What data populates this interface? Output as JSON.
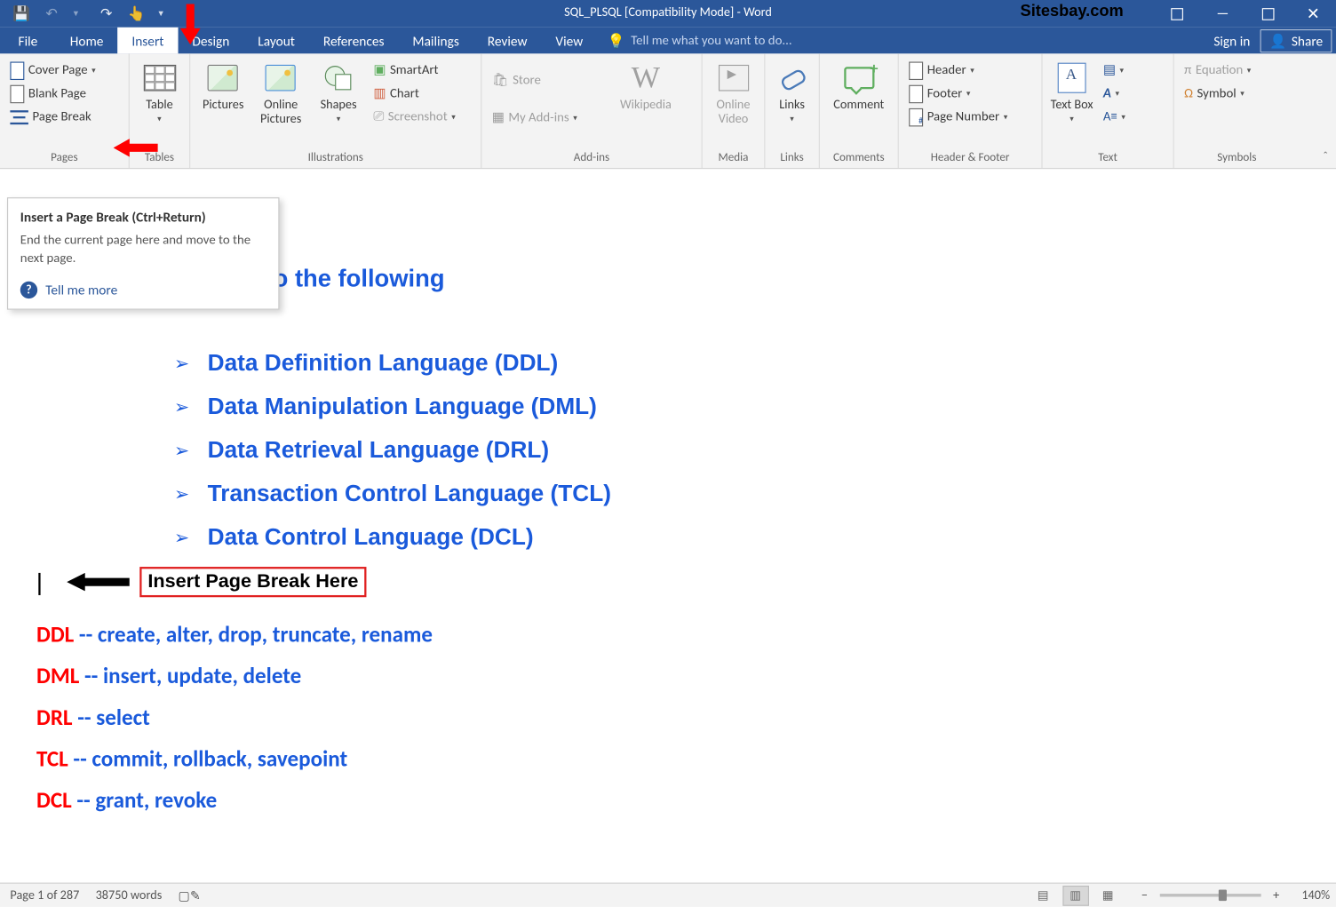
{
  "titlebar": {
    "title": "SQL_PLSQL [Compatibility Mode] - Word",
    "watermark": "Sitesbay.com"
  },
  "tabs": {
    "file": "File",
    "home": "Home",
    "insert": "Insert",
    "design": "Design",
    "layout": "Layout",
    "references": "References",
    "mailings": "Mailings",
    "review": "Review",
    "view": "View",
    "tell_me": "Tell me what you want to do...",
    "sign_in": "Sign in",
    "share": "Share"
  },
  "ribbon": {
    "pages": {
      "cover_page": "Cover Page",
      "blank_page": "Blank Page",
      "page_break": "Page Break",
      "label": "Pages"
    },
    "tables": {
      "table": "Table",
      "label": "Tables"
    },
    "illustrations": {
      "pictures": "Pictures",
      "online_pictures": "Online Pictures",
      "shapes": "Shapes",
      "smartart": "SmartArt",
      "chart": "Chart",
      "screenshot": "Screenshot",
      "label": "Illustrations"
    },
    "addins": {
      "store": "Store",
      "my_addins": "My Add-ins",
      "wikipedia": "Wikipedia",
      "label": "Add-ins"
    },
    "media": {
      "online_video": "Online Video",
      "label": "Media"
    },
    "links": {
      "links": "Links",
      "label": "Links"
    },
    "comments": {
      "comment": "Comment",
      "label": "Comments"
    },
    "header_footer": {
      "header": "Header",
      "footer": "Footer",
      "page_number": "Page Number",
      "label": "Header & Footer"
    },
    "text": {
      "text_box": "Text Box",
      "label": "Text"
    },
    "symbols": {
      "equation": "Equation",
      "symbol": "Symbol",
      "label": "Symbols"
    }
  },
  "tooltip": {
    "title": "Insert a Page Break (Ctrl+Return)",
    "body": "End the current page here and move to the next page.",
    "tell_more": "Tell me more"
  },
  "annotation": {
    "insert_here": "Insert Page Break Here"
  },
  "doc": {
    "heading_right": "o the following",
    "list": [
      "Data Definition Language (DDL)",
      "Data Manipulation Language (DML)",
      "Data Retrieval Language (DRL)",
      "Transaction Control Language (TCL)",
      "Data Control Language (DCL)"
    ],
    "lines": [
      {
        "kw": "DDL",
        "rest": " -- create, alter, drop, truncate, rename"
      },
      {
        "kw": "DML",
        "rest": " -- insert, update, delete"
      },
      {
        "kw": "DRL",
        "rest": " -- select"
      },
      {
        "kw": "TCL",
        "rest": " -- commit, rollback, savepoint"
      },
      {
        "kw": "DCL",
        "rest": " -- grant, revoke"
      }
    ]
  },
  "status": {
    "page": "Page 1 of 287",
    "words": "38750 words",
    "zoom": "140%"
  }
}
